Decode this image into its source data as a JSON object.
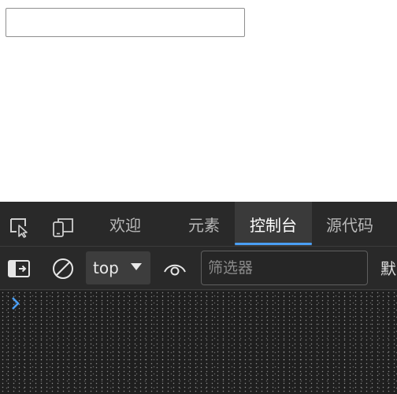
{
  "page": {
    "input_value": ""
  },
  "devtools": {
    "tabs": [
      {
        "label": "欢迎",
        "active": false
      },
      {
        "label": "元素",
        "active": false
      },
      {
        "label": "控制台",
        "active": true
      },
      {
        "label": "源代码",
        "active": false
      }
    ],
    "toolbar_icons": {
      "inspect": "inspect-element-icon",
      "device": "device-emulation-icon",
      "sidebar": "console-sidebar-icon",
      "clear": "clear-console-icon",
      "live_expression": "eye-icon"
    },
    "toolbar": {
      "context": "top",
      "filter_placeholder": "筛选器",
      "levels_label": "默"
    },
    "console": {
      "prompt_icon": "chevron-right-icon"
    },
    "colors": {
      "panel_bg": "#292929",
      "active_tab_underline": "#4a9ff5",
      "prompt": "#4a9ff5"
    }
  }
}
